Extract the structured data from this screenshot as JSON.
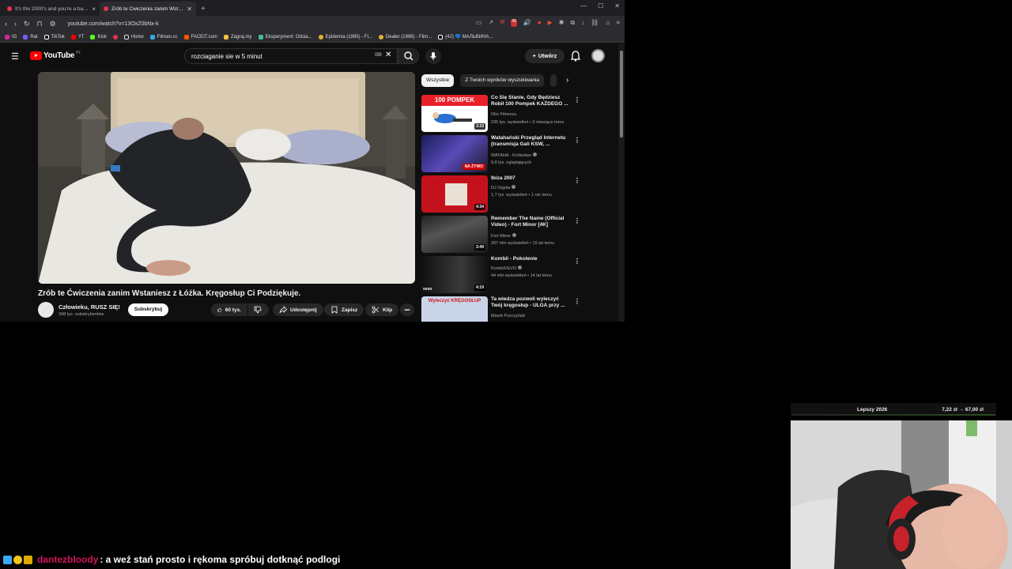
{
  "browser": {
    "tabs": [
      {
        "title": "It's the 2000's and you're a baddie -",
        "active": false
      },
      {
        "title": "Zrób te Ćwiczenia zanim Wstani",
        "active": true
      }
    ],
    "new_tab": "+",
    "url": "youtube.com/watch?v=13OxZ0bNx-k",
    "bookmarks": [
      "IG",
      "Rat",
      "TikTok",
      "YT",
      "Kick",
      "",
      "Home",
      "Filman.cc",
      "FACEIT.com",
      "Zagraj.my",
      "Eksperyment: Odsia...",
      "Epidemia (1995) - Fi...",
      "Dealer (1996) - Film...",
      "(42) 💙 МАЛЬВИНА..."
    ],
    "ext_badge": "49"
  },
  "youtube": {
    "logo": "YouTube",
    "logo_region": "PL",
    "search_value": "rozciaganie sie w 5 minut",
    "create_label": "Utwórz",
    "video_title": "Zrób te Ćwiczenia zanim Wstaniesz z Łóżka. Kręgosłup Ci Podziękuje.",
    "channel_name": "Człowieku, RUSZ SIĘ!",
    "channel_subs": "348 tys. subskrybentów",
    "subscribe_label": "Subskrybuj",
    "likes": "60 tys.",
    "share_label": "Udostępnij",
    "save_label": "Zapisz",
    "clip_label": "Klip",
    "chips": [
      "Wszystkie",
      "Z Twoich wyników wyszukiwania"
    ],
    "recommendations": [
      {
        "title": "Co Się Stanie, Gdy Będziesz Robił 100 Pompek KAŻDEGO ...",
        "channel": "Oko Fitnessu",
        "meta": "236 tys. wyświetleń • 3 miesiące temu",
        "duration": "3:33",
        "thumb_text": "100 POMPEK",
        "verified": false
      },
      {
        "title": "Watahański Przegląd Internetu (transmisja Gali KSW, ...",
        "channel": "WATAHA - Królestwo",
        "meta": "9,8 tys. oglądających",
        "duration": "NA ŻYWO",
        "verified": true
      },
      {
        "title": "Ibiza 2007",
        "channel": "DJ Gigola",
        "meta": "1,7 tys. wyświetleń • 1 rok temu",
        "duration": "4:34",
        "verified": true
      },
      {
        "title": "Remember The Name (Official Video) - Fort Minor [4K]",
        "channel": "Fort Minor",
        "meta": "397 mln wyświetleń • 15 lat temu",
        "duration": "3:49",
        "verified": true
      },
      {
        "title": "Kombii - Pokolenie",
        "channel": "KombiiVEVO",
        "meta": "44 mln wyświetleń • 14 lat temu",
        "duration": "4:19",
        "thumb_text": "vevo",
        "verified": true
      },
      {
        "title": "Ta wiedza pozwoli wyleczyć Twój kręgosłup - ULGA przy ...",
        "channel": "Marek Purczyński",
        "meta": "",
        "duration": "",
        "thumb_text": "Wyleczyć KRĘGOSŁUP",
        "verified": false
      }
    ]
  },
  "overlay": {
    "widget_label": "Lepszy 2026",
    "widget_value": "7,22 zł → 67,00 zł",
    "chat_user": "dantezbloody",
    "chat_message": ": a weź stań prosto i rękoma spróbuj dotknąć podlogi"
  },
  "colors": {
    "yt_red": "#ff0000",
    "chat_user": "#d1125d",
    "bg": "#0f0f0f"
  }
}
